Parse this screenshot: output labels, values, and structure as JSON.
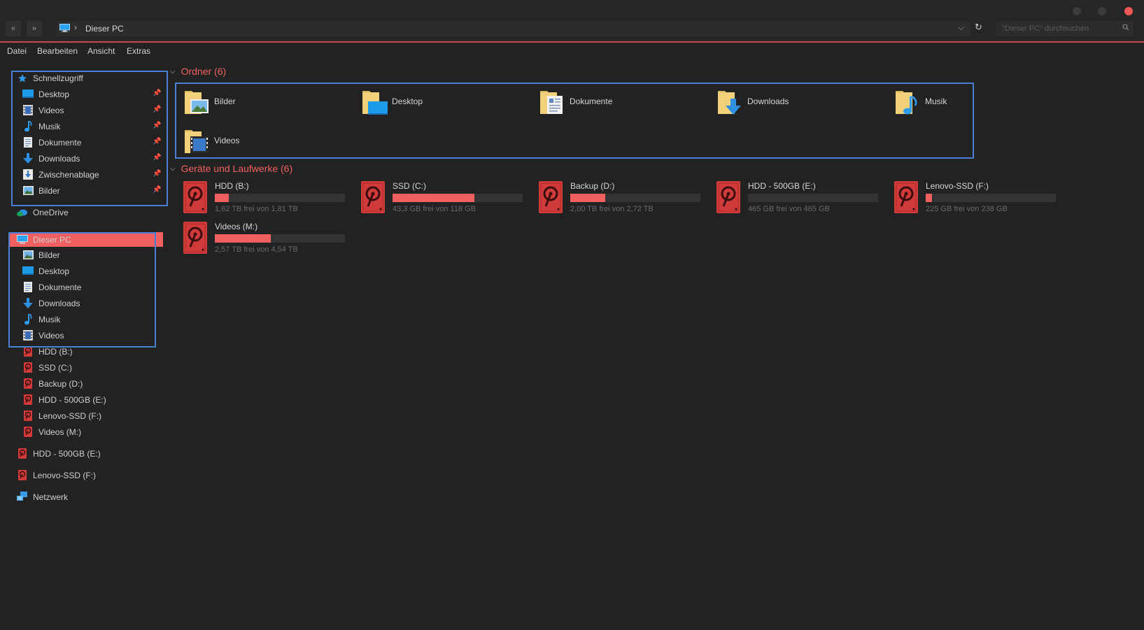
{
  "window": {
    "accent_color": "#f06060",
    "highlight_box_color": "#4a7fd4"
  },
  "address": {
    "back_label": "«",
    "forward_label": "»",
    "separator": "›",
    "path": "Dieser PC",
    "dropdown": "⌵",
    "refresh": "↻",
    "search_placeholder": "\"Dieser PC\" durchsuchen"
  },
  "menu": {
    "items": [
      "Datei",
      "Bearbeiten",
      "Ansicht",
      "Extras"
    ]
  },
  "sidebar": {
    "quick_access": {
      "label": "Schnellzugriff",
      "items": [
        {
          "label": "Desktop",
          "icon": "desktop-icon"
        },
        {
          "label": "Videos",
          "icon": "video-icon"
        },
        {
          "label": "Musik",
          "icon": "music-icon"
        },
        {
          "label": "Dokumente",
          "icon": "document-icon"
        },
        {
          "label": "Downloads",
          "icon": "download-icon"
        },
        {
          "label": "Zwischenablage",
          "icon": "clipboard-icon"
        },
        {
          "label": "Bilder",
          "icon": "pictures-icon"
        }
      ]
    },
    "onedrive": "OneDrive",
    "this_pc": {
      "label": "Dieser PC",
      "folders": [
        {
          "label": "Bilder",
          "icon": "pictures-icon"
        },
        {
          "label": "Desktop",
          "icon": "desktop-icon"
        },
        {
          "label": "Dokumente",
          "icon": "document-icon"
        },
        {
          "label": "Downloads",
          "icon": "download-icon"
        },
        {
          "label": "Musik",
          "icon": "music-icon"
        },
        {
          "label": "Videos",
          "icon": "video-icon"
        }
      ],
      "drives": [
        "HDD (B:)",
        "SSD (C:)",
        "Backup (D:)",
        "HDD - 500GB (E:)",
        "Lenovo-SSD (F:)",
        "Videos (M:)"
      ]
    },
    "extra_drives": [
      "HDD - 500GB (E:)",
      "Lenovo-SSD (F:)"
    ],
    "network": "Netzwerk"
  },
  "main": {
    "folders_heading": "Ordner (6)",
    "folders": [
      {
        "label": "Bilder",
        "icon": "pictures-folder-icon"
      },
      {
        "label": "Desktop",
        "icon": "desktop-folder-icon"
      },
      {
        "label": "Dokumente",
        "icon": "documents-folder-icon"
      },
      {
        "label": "Downloads",
        "icon": "downloads-folder-icon"
      },
      {
        "label": "Musik",
        "icon": "music-folder-icon"
      },
      {
        "label": "Videos",
        "icon": "videos-folder-icon"
      }
    ],
    "drives_heading": "Geräte und Laufwerke (6)",
    "drives": [
      {
        "name": "HDD (B:)",
        "free": "1,62 TB frei von 1,81 TB",
        "used_fraction": 0.11
      },
      {
        "name": "SSD (C:)",
        "free": "43,3 GB frei von 118 GB",
        "used_fraction": 0.63
      },
      {
        "name": "Backup (D:)",
        "free": "2,00 TB frei von 2,72 TB",
        "used_fraction": 0.27
      },
      {
        "name": "HDD - 500GB (E:)",
        "free": "465 GB frei von 465 GB",
        "used_fraction": 0.0
      },
      {
        "name": "Lenovo-SSD (F:)",
        "free": "225 GB frei von 238 GB",
        "used_fraction": 0.05
      },
      {
        "name": "Videos (M:)",
        "free": "2,57 TB frei von 4,54 TB",
        "used_fraction": 0.43
      }
    ]
  }
}
